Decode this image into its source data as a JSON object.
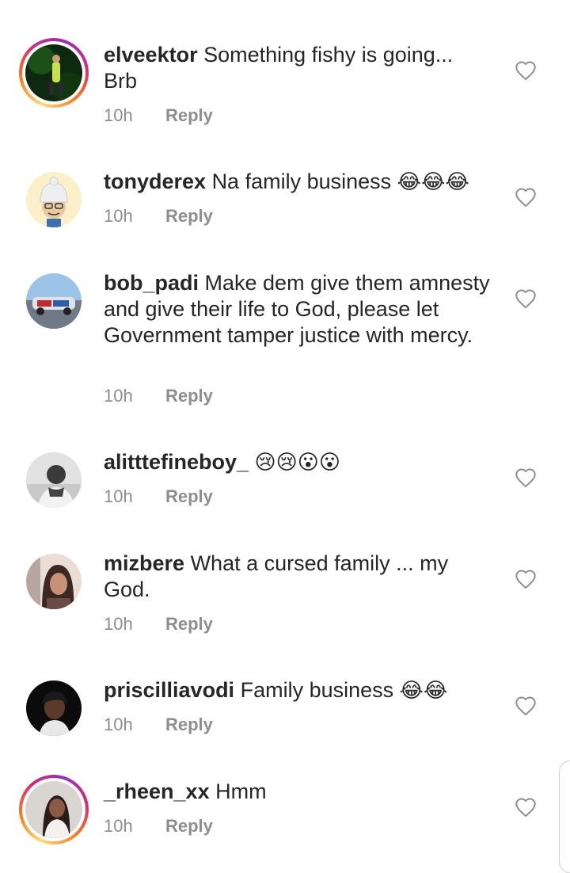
{
  "comments": [
    {
      "username": "elveektor",
      "text": "Something fishy is going... Brb",
      "emoji": "",
      "time": "10h",
      "reply": "Reply",
      "story_ring": true
    },
    {
      "username": "tonyderex",
      "text": "Na family business",
      "emoji": "😂😂😂",
      "time": "10h",
      "reply": "Reply",
      "story_ring": false
    },
    {
      "username": "bob_padi",
      "text": "Make dem give them amnesty and give their life to God, please let Government tamper justice with mercy.",
      "emoji": "",
      "time": "10h",
      "reply": "Reply",
      "story_ring": false
    },
    {
      "username": "alitttefineboy_",
      "text": "",
      "emoji": "😢😢😮😮",
      "time": "10h",
      "reply": "Reply",
      "story_ring": false
    },
    {
      "username": "mizbere",
      "text": "What a cursed family ... my God.",
      "emoji": "",
      "time": "10h",
      "reply": "Reply",
      "story_ring": false
    },
    {
      "username": "priscilliavodi",
      "text": "Family business",
      "emoji": "😂😂",
      "time": "10h",
      "reply": "Reply",
      "story_ring": false
    },
    {
      "username": "_rheen_xx",
      "text": "Hmm",
      "emoji": "",
      "time": "10h",
      "reply": "Reply",
      "story_ring": true
    }
  ],
  "icons": {
    "like": "heart-outline-icon"
  },
  "colors": {
    "text": "#262626",
    "meta": "#8e8e8e",
    "background": "#ffffff"
  }
}
